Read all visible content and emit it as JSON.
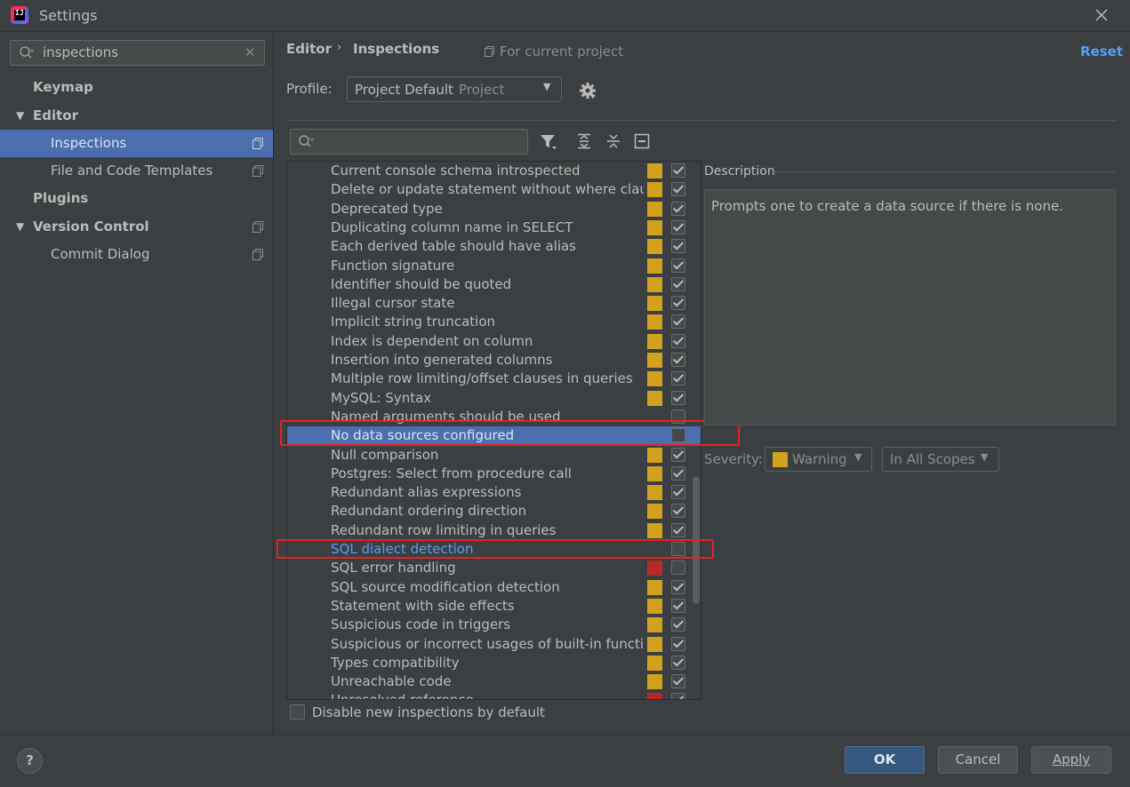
{
  "window": {
    "title": "Settings",
    "logo_text": "IJ"
  },
  "sidebar": {
    "search_value": "inspections",
    "items": [
      {
        "label": "Keymap"
      },
      {
        "label": "Editor"
      },
      {
        "label": "Inspections"
      },
      {
        "label": "File and Code Templates"
      },
      {
        "label": "Plugins"
      },
      {
        "label": "Version Control"
      },
      {
        "label": "Commit Dialog"
      }
    ]
  },
  "header": {
    "breadcrumb_editor": "Editor",
    "breadcrumb_sep": "›",
    "breadcrumb_current": "Inspections",
    "scope_note": "For current project",
    "reset_label": "Reset"
  },
  "profile": {
    "label": "Profile:",
    "value": "Project Default",
    "sub": "Project"
  },
  "colors": {
    "warning": "#d2a11e",
    "error": "#b8282b",
    "selection": "#4b6eaf",
    "link": "#589df6",
    "annotation": "#e52222"
  },
  "inspections": [
    {
      "name": "Current console schema introspected",
      "severity": "warning",
      "enabled": true
    },
    {
      "name": "Delete or update statement without where claus",
      "severity": "warning",
      "enabled": true
    },
    {
      "name": "Deprecated type",
      "severity": "warning",
      "enabled": true
    },
    {
      "name": "Duplicating column name in SELECT",
      "severity": "warning",
      "enabled": true
    },
    {
      "name": "Each derived table should have alias",
      "severity": "warning",
      "enabled": true
    },
    {
      "name": "Function signature",
      "severity": "warning",
      "enabled": true
    },
    {
      "name": "Identifier should be quoted",
      "severity": "warning",
      "enabled": true
    },
    {
      "name": "Illegal cursor state",
      "severity": "warning",
      "enabled": true
    },
    {
      "name": "Implicit string truncation",
      "severity": "warning",
      "enabled": true
    },
    {
      "name": "Index is dependent on column",
      "severity": "warning",
      "enabled": true
    },
    {
      "name": "Insertion into generated columns",
      "severity": "warning",
      "enabled": true
    },
    {
      "name": "Multiple row limiting/offset clauses in queries",
      "severity": "warning",
      "enabled": true
    },
    {
      "name": "MySQL: Syntax",
      "severity": "warning",
      "enabled": true
    },
    {
      "name": "Named arguments should be used",
      "severity": "none",
      "enabled": false
    },
    {
      "name": "No data sources configured",
      "severity": "none",
      "enabled": false
    },
    {
      "name": "Null comparison",
      "severity": "warning",
      "enabled": true
    },
    {
      "name": "Postgres: Select from procedure call",
      "severity": "warning",
      "enabled": true
    },
    {
      "name": "Redundant alias expressions",
      "severity": "warning",
      "enabled": true
    },
    {
      "name": "Redundant ordering direction",
      "severity": "warning",
      "enabled": true
    },
    {
      "name": "Redundant row limiting in queries",
      "severity": "warning",
      "enabled": true
    },
    {
      "name": "SQL dialect detection",
      "severity": "none",
      "enabled": false
    },
    {
      "name": "SQL error handling",
      "severity": "error",
      "enabled": false
    },
    {
      "name": "SQL source modification detection",
      "severity": "warning",
      "enabled": true
    },
    {
      "name": "Statement with side effects",
      "severity": "warning",
      "enabled": true
    },
    {
      "name": "Suspicious code in triggers",
      "severity": "warning",
      "enabled": true
    },
    {
      "name": "Suspicious or incorrect usages of built-in functio",
      "severity": "warning",
      "enabled": true
    },
    {
      "name": "Types compatibility",
      "severity": "warning",
      "enabled": true
    },
    {
      "name": "Unreachable code",
      "severity": "warning",
      "enabled": true
    },
    {
      "name": "Unresolved reference",
      "severity": "error",
      "enabled": true
    }
  ],
  "selected_index": 14,
  "link_index": 20,
  "description": {
    "label": "Description",
    "text": "Prompts one to create a data source if there is none."
  },
  "severity": {
    "label": "Severity:",
    "value": "Warning",
    "scope": "In All Scopes"
  },
  "disable_new": {
    "label": "Disable new inspections by default",
    "checked": false
  },
  "footer": {
    "help": "?",
    "ok": "OK",
    "cancel": "Cancel",
    "apply": "Apply"
  }
}
